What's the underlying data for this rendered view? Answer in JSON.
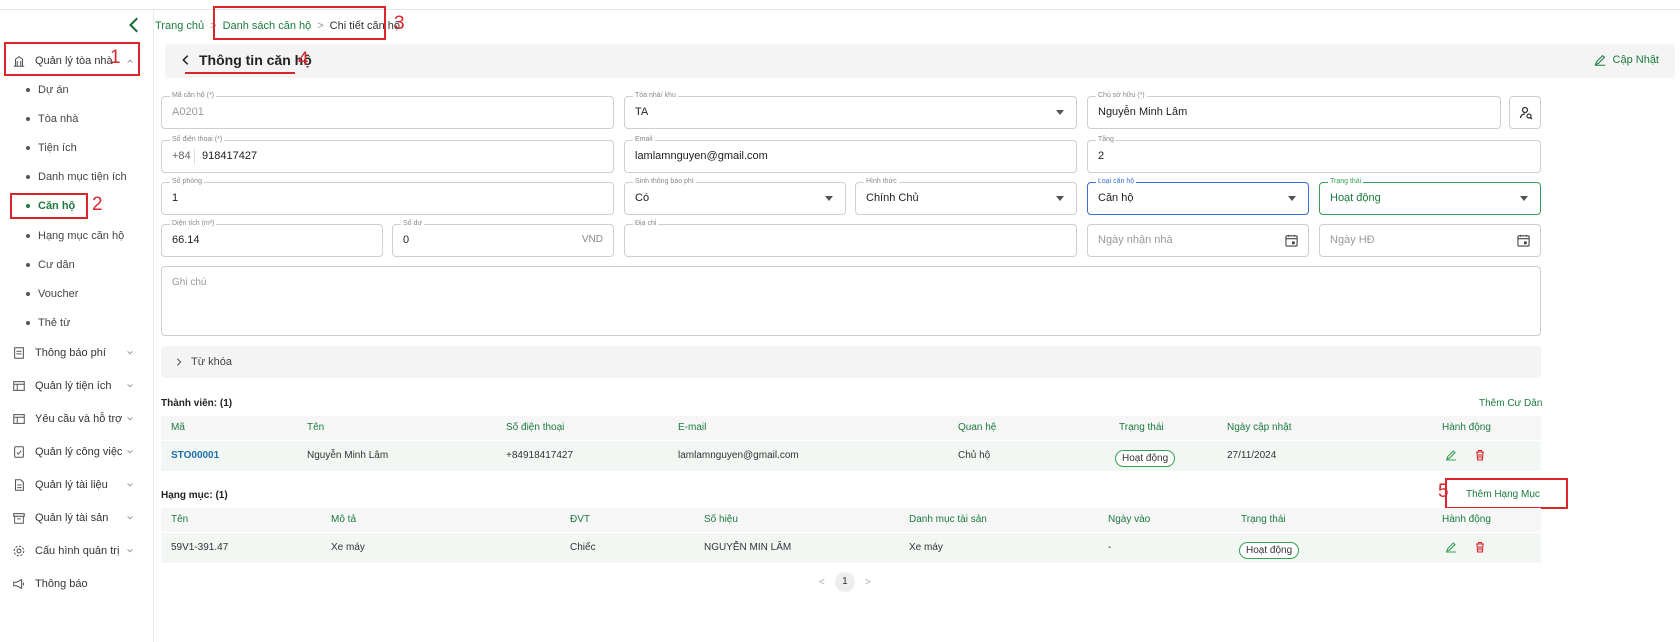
{
  "sidebar": {
    "groups": [
      {
        "label": "Quản lý tòa nhà",
        "icon": "building-icon"
      },
      {
        "label": "Thông báo phí",
        "icon": "receipt-icon"
      },
      {
        "label": "Quản lý tiện ích",
        "icon": "table-icon"
      },
      {
        "label": "Yêu cầu và hỗ trợ",
        "icon": "table-icon"
      },
      {
        "label": "Quản lý công việc",
        "icon": "task-icon"
      },
      {
        "label": "Quản lý tài liệu",
        "icon": "document-icon"
      },
      {
        "label": "Quản lý tài sản",
        "icon": "archive-icon"
      },
      {
        "label": "Cấu hình quản trị",
        "icon": "gear-icon"
      },
      {
        "label": "Thông báo",
        "icon": "megaphone-icon"
      }
    ],
    "sub_items": [
      "Dự án",
      "Tòa nhà",
      "Tiện ích",
      "Danh mục tiện ích",
      "Căn hộ",
      "Hạng mục căn hộ",
      "Cư dân",
      "Voucher",
      "Thẻ từ"
    ],
    "active_sub": "Căn hộ"
  },
  "annotations": [
    "1",
    "2",
    "3",
    "4",
    "5"
  ],
  "breadcrumb": {
    "home": "Trang chủ",
    "list": "Danh sách căn hộ",
    "current": "Chi tiết căn hộ",
    "sep": ">"
  },
  "header": {
    "title": "Thông tin căn hộ",
    "update_label": "Cập Nhật"
  },
  "form": {
    "apartment_code": {
      "label": "Mã căn hộ (*)",
      "value": "A0201"
    },
    "building": {
      "label": "Tòa nhà/ khu",
      "value": "TA"
    },
    "owner": {
      "label": "Chủ sở hữu (*)",
      "value": "Nguyễn Minh Lâm"
    },
    "phone": {
      "label": "Số điện thoại (*)",
      "prefix": "+84",
      "value": "918417427"
    },
    "email": {
      "label": "Email",
      "value": "lamlamnguyen@gmail.com"
    },
    "floor": {
      "label": "Tầng",
      "value": "2"
    },
    "room_no": {
      "label": "Số phòng",
      "value": "1"
    },
    "fee_notice": {
      "label": "Sinh thông báo phí",
      "value": "Có"
    },
    "form_type": {
      "label": "Hình thức",
      "value": "Chính Chủ"
    },
    "apt_type": {
      "label": "Loại căn hộ",
      "value": "Căn hộ"
    },
    "status": {
      "label": "Trạng thái",
      "value": "Hoạt động"
    },
    "area": {
      "label": "Diện tích (m²)",
      "value": "66.14"
    },
    "balance": {
      "label": "Số dư",
      "value": "0",
      "suffix": "VND"
    },
    "address": {
      "label": "Địa chỉ",
      "value": ""
    },
    "receive_date": {
      "placeholder": "Ngày nhận nhà"
    },
    "contract_date": {
      "placeholder": "Ngày HĐ"
    },
    "notes": {
      "placeholder": "Ghi chú"
    }
  },
  "keyword": {
    "label": "Từ khóa"
  },
  "members": {
    "title": "Thành viên:",
    "count": "(1)",
    "add_label": "Thêm Cư Dân",
    "columns": [
      "Mã",
      "Tên",
      "Số điện thoại",
      "E-mail",
      "Quan hệ",
      "Trạng thái",
      "Ngày cập nhật",
      "Hành động"
    ],
    "rows": [
      {
        "code": "STO00001",
        "name": "Nguyễn Minh Lâm",
        "phone": "+84918417427",
        "email": "lamlamnguyen@gmail.com",
        "relation": "Chủ hộ",
        "status": "Hoạt động",
        "updated": "27/11/2024"
      }
    ]
  },
  "items": {
    "title": "Hạng mục:",
    "count": "(1)",
    "add_label": "Thêm Hạng Mục",
    "columns": [
      "Tên",
      "Mô tả",
      "ĐVT",
      "Số hiệu",
      "Danh mục tài sản",
      "Ngày vào",
      "Trạng thái",
      "Hành động"
    ],
    "rows": [
      {
        "name": "59V1-391.47",
        "desc": "Xe máy",
        "unit": "Chiếc",
        "serial": "NGUYỄN MIN LÂM",
        "category": "Xe máy",
        "date": "-",
        "status": "Hoạt động"
      }
    ]
  },
  "pagination": {
    "current": "1",
    "prev": "<",
    "next": ">"
  },
  "colors": {
    "accent": "#1b7a3e",
    "annotation": "#d9262c",
    "focus_blue": "#3b6fd4"
  }
}
